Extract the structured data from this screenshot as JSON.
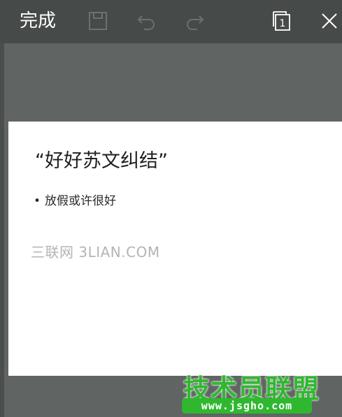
{
  "toolbar": {
    "done_label": "完成",
    "icons": {
      "save": "save-icon",
      "undo": "undo-icon",
      "redo": "redo-icon",
      "pages": "pages-icon",
      "close": "close-icon"
    },
    "pages_count": "1"
  },
  "slide": {
    "title": "“好好苏文纠结”",
    "bullet": "放假或许很好",
    "watermark": "三联网 3LIAN.COM"
  },
  "site_logo": {
    "name": "技术员联盟",
    "url": "www.jsgho.com"
  },
  "colors": {
    "toolbar_bg": "#464a48",
    "canvas_bg": "#606462",
    "slide_bg": "#ffffff",
    "logo_green": "#2fb82f"
  }
}
